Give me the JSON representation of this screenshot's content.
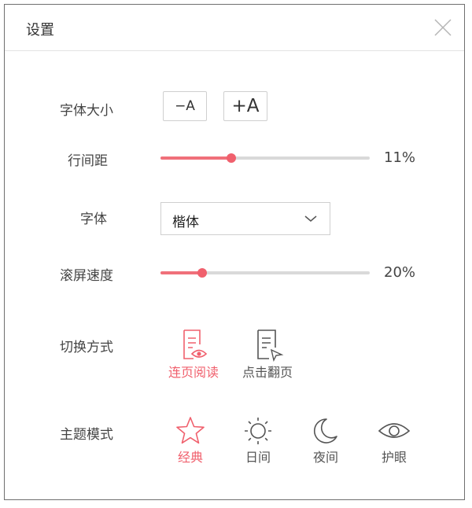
{
  "dialog": {
    "title": "设置"
  },
  "font_size": {
    "label": "字体大小",
    "decrease_label": "−A",
    "increase_label": "+A"
  },
  "line_spacing": {
    "label": "行间距",
    "value": "11%",
    "fraction": 0.34
  },
  "font_family": {
    "label": "字体",
    "selected": "楷体"
  },
  "scroll_speed": {
    "label": "滚屏速度",
    "value": "20%",
    "fraction": 0.2
  },
  "page_mode": {
    "label": "切换方式",
    "options": [
      {
        "label": "连页阅读",
        "icon": "continuous-page-icon",
        "active": true
      },
      {
        "label": "点击翻页",
        "icon": "click-page-icon",
        "active": false
      }
    ]
  },
  "theme": {
    "label": "主题模式",
    "options": [
      {
        "label": "经典",
        "icon": "star-icon",
        "active": true
      },
      {
        "label": "日间",
        "icon": "sun-icon",
        "active": false
      },
      {
        "label": "夜间",
        "icon": "moon-icon",
        "active": false
      },
      {
        "label": "护眼",
        "icon": "eye-icon",
        "active": false
      }
    ]
  },
  "colors": {
    "accent": "#f0606d",
    "track": "#d9d9d9",
    "text": "#444444"
  }
}
